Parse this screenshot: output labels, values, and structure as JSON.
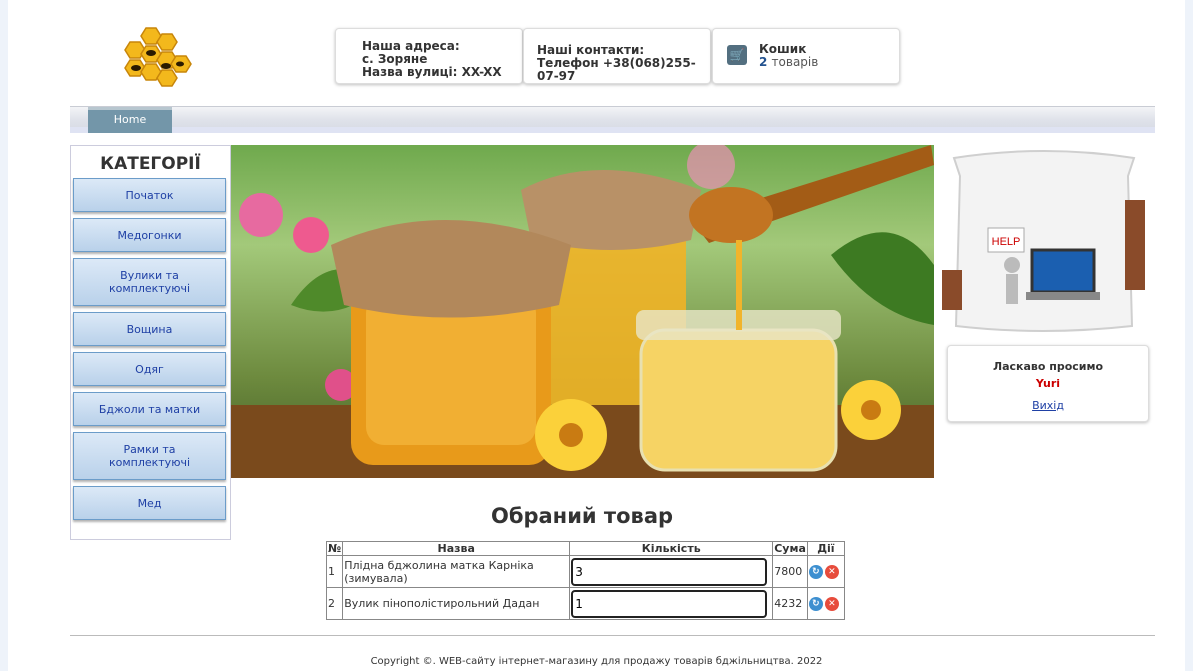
{
  "header": {
    "address": {
      "line1": "Наша адреса:",
      "line2": "с. Зоряне",
      "line3": "Назва вулиці: XX-XX"
    },
    "contacts": {
      "line1": "Наші контакти:",
      "line2": "Телефон +38(068)255-07-97"
    },
    "cart": {
      "label": "Кошик",
      "count": "2",
      "unit": "товарів"
    }
  },
  "nav": {
    "home": "Home"
  },
  "categories": {
    "title": "КАТЕГОРІЇ",
    "items": [
      "Початок",
      "Медогонки",
      "Вулики та комплектуючі",
      "Вощина",
      "Одяг",
      "Бджоли та матки",
      "Рамки та комплектуючі",
      "Мед"
    ]
  },
  "help_sign": "HELP",
  "welcome": {
    "greeting": "Ласкаво просимо",
    "user": "Yuri",
    "logout": "Вихід"
  },
  "cart_section": {
    "title": "Обраний товар",
    "columns": [
      "№",
      "Назва",
      "Кількість",
      "Сума",
      "Дії"
    ],
    "rows": [
      {
        "num": "1",
        "name": "Плідна бджолина матка Карніка (зимувала)",
        "qty": "3",
        "sum": "7800"
      },
      {
        "num": "2",
        "name": "Вулик пінополістирольний Дадан",
        "qty": "1",
        "sum": "4232"
      }
    ]
  },
  "footer": "Copyright ©. WEB-сайту інтернет-магазину для продажу товарів бджільництва. 2022",
  "icons": [
    "bee-logo-icon",
    "cart-icon",
    "refresh-icon",
    "delete-icon"
  ],
  "colors": {
    "link": "#1f40a5",
    "user": "#cc0000",
    "nav_tab": "#7396a9",
    "category_border": "#6b9cc9"
  }
}
